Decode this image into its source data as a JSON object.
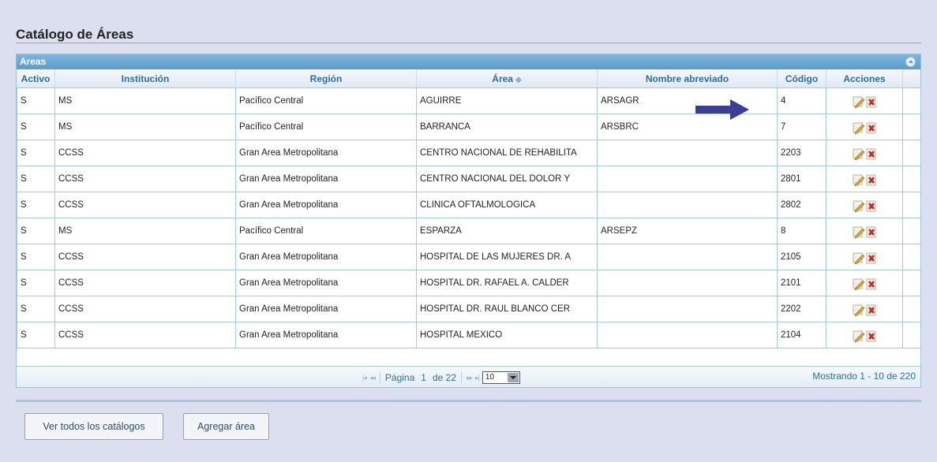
{
  "page": {
    "title": "Catálogo de Áreas"
  },
  "grid": {
    "caption": "Areas",
    "columns": [
      {
        "label": "Activo"
      },
      {
        "label": "Institución"
      },
      {
        "label": "Región"
      },
      {
        "label": "Área",
        "sort_icon": "◆"
      },
      {
        "label": "Nombre abreviado"
      },
      {
        "label": "Código"
      },
      {
        "label": "Acciones"
      }
    ],
    "rows": [
      {
        "activo": "S",
        "institucion": "MS",
        "region": "Pacífico Central",
        "area": "AGUIRRE",
        "abreviado": "ARSAGR",
        "codigo": "4"
      },
      {
        "activo": "S",
        "institucion": "MS",
        "region": "Pacífico Central",
        "area": "BARRANCA",
        "abreviado": "ARSBRC",
        "codigo": "7"
      },
      {
        "activo": "S",
        "institucion": "CCSS",
        "region": "Gran Area Metropolitana",
        "area": "CENTRO NACIONAL DE REHABILITA",
        "abreviado": "",
        "codigo": "2203"
      },
      {
        "activo": "S",
        "institucion": "CCSS",
        "region": "Gran Area Metropolitana",
        "area": "CENTRO NACIONAL DEL DOLOR Y",
        "abreviado": "",
        "codigo": "2801"
      },
      {
        "activo": "S",
        "institucion": "CCSS",
        "region": "Gran Area Metropolitana",
        "area": "CLINICA OFTALMOLOGICA",
        "abreviado": "",
        "codigo": "2802"
      },
      {
        "activo": "S",
        "institucion": "MS",
        "region": "Pacífico Central",
        "area": "ESPARZA",
        "abreviado": "ARSEPZ",
        "codigo": "8"
      },
      {
        "activo": "S",
        "institucion": "CCSS",
        "region": "Gran Area Metropolitana",
        "area": "HOSPITAL DE LAS MUJERES DR. A",
        "abreviado": "",
        "codigo": "2105"
      },
      {
        "activo": "S",
        "institucion": "CCSS",
        "region": "Gran Area Metropolitana",
        "area": "HOSPITAL DR. RAFAEL A. CALDER",
        "abreviado": "",
        "codigo": "2101"
      },
      {
        "activo": "S",
        "institucion": "CCSS",
        "region": "Gran Area Metropolitana",
        "area": "HOSPITAL DR. RAUL BLANCO CER",
        "abreviado": "",
        "codigo": "2202"
      },
      {
        "activo": "S",
        "institucion": "CCSS",
        "region": "Gran Area Metropolitana",
        "area": "HOSPITAL MEXICO",
        "abreviado": "",
        "codigo": "2104"
      }
    ]
  },
  "pager": {
    "first_icon": "|◂",
    "prev_icon": "◂◂",
    "next_icon": "▸▸",
    "last_icon": "▸|",
    "page_label": "Página",
    "page_value": "1",
    "of_label": "de 22",
    "rows_per_page": "10",
    "record_info": "Mostrando 1 - 10 de 220"
  },
  "buttons": {
    "view_all": "Ver todos los catálogos",
    "add_area": "Agregar área"
  },
  "colors": {
    "accent": "#5c9ccc",
    "arrow": "#3a3f96",
    "header_text": "#2e6e9e"
  },
  "icons": {
    "edit": "pencil-edit-icon",
    "delete": "delete-document-icon",
    "collapse": "collapse-icon",
    "arrow": "right-arrow-icon"
  }
}
